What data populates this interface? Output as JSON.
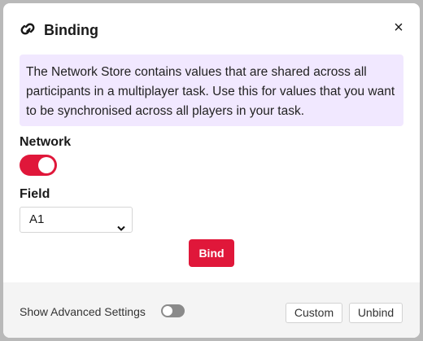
{
  "dialog": {
    "title": "Binding",
    "title_icon": "link-icon",
    "close_label": "×",
    "info_text": "The Network Store contains values that are shared across all participants in a multiplayer task. Use this for values that you want to be synchronised across all players in your task."
  },
  "network": {
    "label": "Network",
    "enabled": true
  },
  "field": {
    "label": "Field",
    "selected": "A1"
  },
  "actions": {
    "bind_label": "Bind"
  },
  "footer": {
    "advanced_label": "Show Advanced Settings",
    "advanced_enabled": false,
    "custom_label": "Custom",
    "unbind_label": "Unbind"
  },
  "colors": {
    "accent": "#e0173a",
    "info_background": "#f1e8ff",
    "footer_background": "#f4f4f4",
    "toggle_off": "#8a8a8a"
  }
}
